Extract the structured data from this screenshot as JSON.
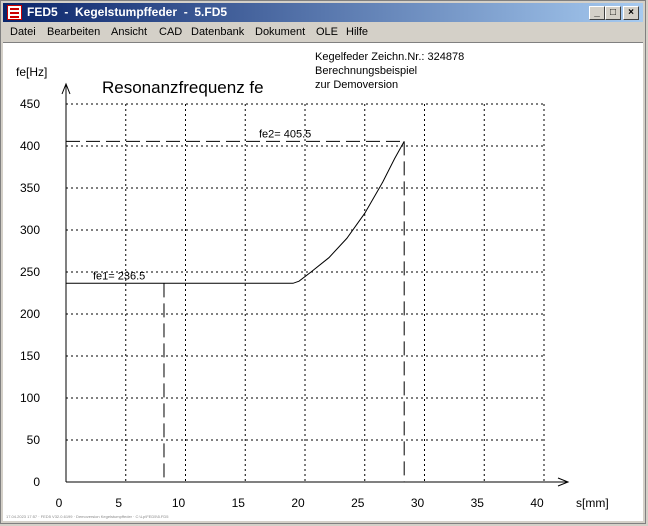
{
  "window": {
    "title": "FED5  -  Kegelstumpffeder  -  5.FD5",
    "minimize_label": "_",
    "maximize_label": "□",
    "close_label": "×"
  },
  "menu": [
    "Datei",
    "Bearbeiten",
    "Ansicht",
    "CAD",
    "Datenbank",
    "Dokument",
    "OLE",
    "Hilfe"
  ],
  "info": {
    "line1": "Kegelfeder  Zeichn.Nr.: 324878",
    "line2": "Berechnungsbeispiel",
    "line3": "zur Demoversion"
  },
  "footer": "17.04.2023 17:57 · FED5 V32.0.6199 · Demoversion Kegelstumpffeder · C:\\Lp\\FED5\\5.FD5",
  "chart_data": {
    "type": "line",
    "title": "Resonanzfrequenz fe",
    "xlabel": "s[mm]",
    "ylabel": "fe[Hz]",
    "xlim": [
      0,
      40
    ],
    "ylim": [
      0,
      450
    ],
    "xticks": [
      0,
      5,
      10,
      15,
      20,
      25,
      30,
      35,
      40
    ],
    "yticks": [
      0,
      50,
      100,
      150,
      200,
      250,
      300,
      350,
      400,
      450
    ],
    "grid": true,
    "series": [
      {
        "x": [
          0,
          19.0,
          19.5,
          20.5,
          22.0,
          23.5,
          25.0,
          26.5,
          27.5,
          28.3
        ],
        "y": [
          236.5,
          236.5,
          239,
          250,
          267,
          290,
          320,
          357,
          385,
          405.5
        ]
      }
    ],
    "annotations": [
      {
        "text": "fe1= 236.5",
        "x": 8.2,
        "y": 236.5
      },
      {
        "text": "fe2= 405.5",
        "x": 28.3,
        "y": 405.5
      }
    ]
  }
}
